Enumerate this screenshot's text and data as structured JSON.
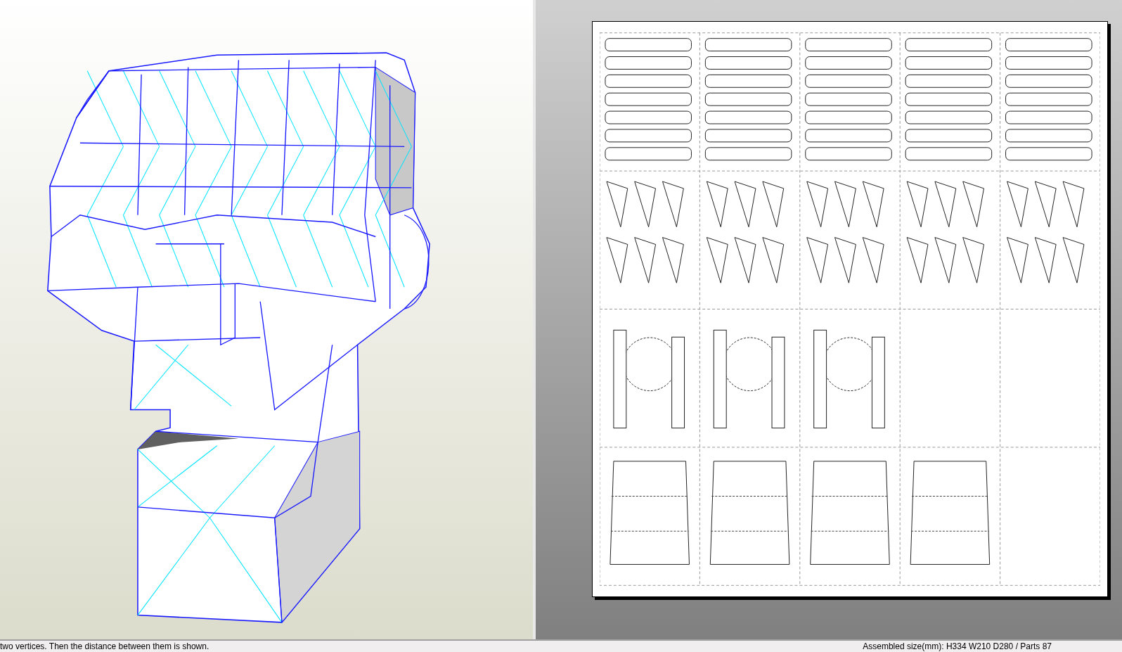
{
  "status_bar": {
    "message": "two vertices. Then the distance between them is shown.",
    "summary": "Assembled size(mm): H334 W210 D280 / Parts 87"
  }
}
